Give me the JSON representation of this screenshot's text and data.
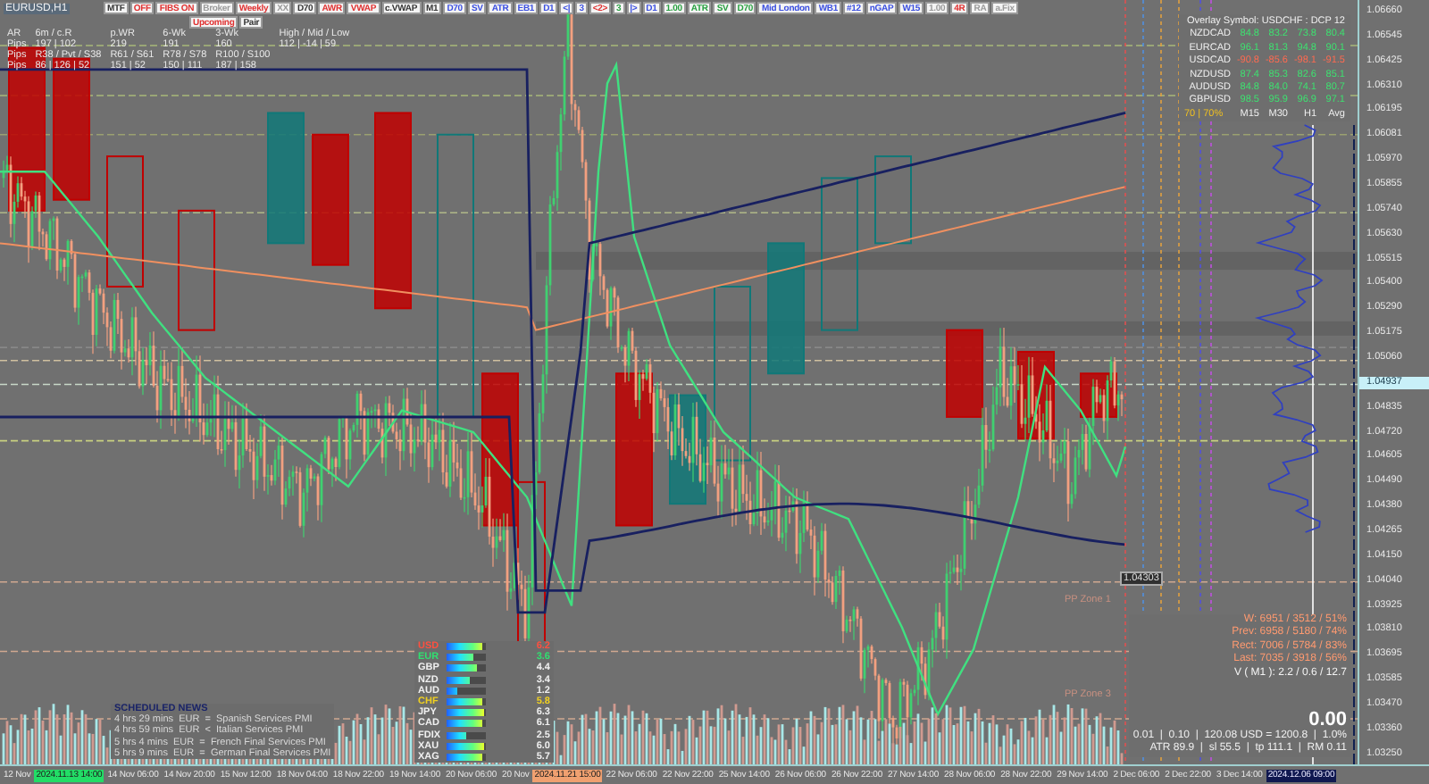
{
  "symbol": "EURUSD,H1",
  "toolbar": [
    {
      "label": "MTF",
      "color": "#333333"
    },
    {
      "label": "OFF",
      "color": "#e03030"
    },
    {
      "label": "FIBS ON",
      "color": "#e03030"
    },
    {
      "label": "Broker",
      "color": "#9a9a9a"
    },
    {
      "label": "Weekly",
      "color": "#e03030"
    },
    {
      "label": "XX",
      "color": "#9a9a9a"
    },
    {
      "label": "D70",
      "color": "#333333"
    },
    {
      "label": "AWR",
      "color": "#e03030"
    },
    {
      "label": "VWAP",
      "color": "#e03030"
    },
    {
      "label": "c.VWAP",
      "color": "#333333"
    },
    {
      "label": "M1",
      "color": "#333333"
    },
    {
      "label": "D70",
      "color": "#3a4ee0"
    },
    {
      "label": "SV",
      "color": "#3a4ee0"
    },
    {
      "label": "ATR",
      "color": "#3a4ee0"
    },
    {
      "label": "EB1",
      "color": "#3a4ee0"
    },
    {
      "label": "D1",
      "color": "#3a4ee0"
    },
    {
      "label": "<|",
      "color": "#3a4ee0"
    },
    {
      "label": "3",
      "color": "#3a4ee0"
    },
    {
      "label": "<2>",
      "color": "#e03030"
    },
    {
      "label": "3",
      "color": "#28a040"
    },
    {
      "label": "|>",
      "color": "#3a4ee0"
    },
    {
      "label": "D1",
      "color": "#3a4ee0"
    },
    {
      "label": "1.00",
      "color": "#28a040"
    },
    {
      "label": "ATR",
      "color": "#28a040"
    },
    {
      "label": "SV",
      "color": "#28a040"
    },
    {
      "label": "D70",
      "color": "#28a040"
    },
    {
      "label": "Mid London",
      "color": "#3a4ee0"
    },
    {
      "label": "WB1",
      "color": "#3a4ee0"
    },
    {
      "label": "#12",
      "color": "#3a4ee0"
    },
    {
      "label": "nGAP",
      "color": "#3a4ee0"
    },
    {
      "label": "W15",
      "color": "#3a4ee0"
    },
    {
      "label": "1.00",
      "color": "#9a9a9a"
    },
    {
      "label": "4R",
      "color": "#e03030"
    },
    {
      "label": "RA",
      "color": "#9a9a9a"
    },
    {
      "label": "a.Fix",
      "color": "#9a9a9a"
    }
  ],
  "toolbar_row_2": [
    {
      "label": "Upcoming",
      "color": "#e03030"
    },
    {
      "label": "Pair",
      "color": "#333333"
    }
  ],
  "info_table": {
    "rows": [
      [
        "AR",
        "6m / c.R",
        "p.WR",
        "6-Wk",
        "3-Wk",
        "High / Mid / Low"
      ],
      [
        "Pips",
        "197 | 102",
        "219",
        "191",
        "160",
        "112 | -14 | 59"
      ],
      [
        "Pips",
        "R38 / Pvt / S38",
        "R61 / S61",
        "R78 / S78",
        "R100 / S100",
        ""
      ],
      [
        "Pips",
        "86 | 126 | 52",
        "151 | 52",
        "150 | 111",
        "187 | 158",
        ""
      ]
    ]
  },
  "overlay_panel": {
    "title": "Overlay Symbol: USDCHF : DCP 12",
    "rows": [
      {
        "pair": "NZDCAD",
        "values": [
          "84.8",
          "83.2",
          "73.8",
          "80.4"
        ],
        "color": "#3ee070"
      },
      {
        "pair": "EURCAD",
        "values": [
          "96.1",
          "81.3",
          "94.8",
          "90.1"
        ],
        "color": "#3ee070"
      },
      {
        "pair": "USDCAD",
        "values": [
          "-90.8",
          "-85.6",
          "-98.1",
          "-91.5"
        ],
        "color": "#ff6a50"
      },
      {
        "pair": "NZDUSD",
        "values": [
          "87.4",
          "85.3",
          "82.6",
          "85.1"
        ],
        "color": "#3ee070"
      },
      {
        "pair": "AUDUSD",
        "values": [
          "84.8",
          "84.0",
          "74.1",
          "80.7"
        ],
        "color": "#3ee070"
      },
      {
        "pair": "GBPUSD",
        "values": [
          "98.5",
          "95.9",
          "96.9",
          "97.1"
        ],
        "color": "#3ee070"
      }
    ],
    "footer": [
      "70 | 70%",
      "M15",
      "M30",
      "H1",
      "Avg"
    ]
  },
  "strength": [
    {
      "name": "USD",
      "color": "#ff5040",
      "level": 0.9,
      "value": "6.2"
    },
    {
      "name": "EUR",
      "color": "#30e070",
      "level": 0.7,
      "value": "3.6"
    },
    {
      "name": "GBP",
      "color": "#f0f0f0",
      "level": 0.75,
      "value": "4.4"
    },
    {
      "name": "NZD",
      "color": "#f0f0f0",
      "level": 0.6,
      "value": "3.4"
    },
    {
      "name": "AUD",
      "color": "#f0f0f0",
      "level": 0.25,
      "value": "1.2"
    },
    {
      "name": "CHF",
      "color": "#f0d020",
      "level": 0.9,
      "value": "5.8"
    },
    {
      "name": "JPY",
      "color": "#f0f0f0",
      "level": 0.95,
      "value": "6.3"
    },
    {
      "name": "CAD",
      "color": "#f0f0f0",
      "level": 0.9,
      "value": "6.1"
    },
    {
      "name": "FDIX",
      "color": "#f0f0f0",
      "level": 0.5,
      "value": "2.5"
    },
    {
      "name": "XAU",
      "color": "#f0f0f0",
      "level": 0.95,
      "value": "6.0"
    },
    {
      "name": "XAG",
      "color": "#f0f0f0",
      "level": 0.9,
      "value": "5.7"
    }
  ],
  "news": {
    "title": "SCHEDULED NEWS",
    "items": [
      "4 hrs 29 mins  EUR  =  Spanish Services PMI",
      "4 hrs 59 mins  EUR  <  Italian Services PMI",
      "5 hrs 4 mins  EUR  =  French Final Services PMI",
      "5 hrs 9 mins  EUR  =  German Final Services PMI"
    ]
  },
  "stats": [
    {
      "text": "W: 6951 / 3512 / 51%",
      "color": "#ff9a70"
    },
    {
      "text": "Prev: 6958 / 5180 / 74%",
      "color": "#ff9a70"
    },
    {
      "text": "Rect: 7006 / 5784 / 83%",
      "color": "#ff9a70"
    },
    {
      "text": "Last: 7035 / 3918 / 56%",
      "color": "#ff9a70"
    },
    {
      "text": "V ( M1 ): 2.2 / 0.6 / 12.7",
      "color": "#f4f4f4"
    }
  ],
  "balance": "0.00",
  "risk_line": "0.01  |  0.10  |  120.08 USD = 1200.8  |  1.0%",
  "atr_line": "ATR 89.9  |  sl 55.5  |  tp 111.1  |  RM 0.11",
  "chart_labels": [
    {
      "text": "PP Zone 1",
      "kind": "zone"
    },
    {
      "text": "PP Zone 3",
      "kind": "zone"
    },
    {
      "text": "1.04303",
      "kind": "price"
    }
  ],
  "price_axis": [
    {
      "text": "1.06660"
    },
    {
      "text": "1.06545"
    },
    {
      "text": "1.06425"
    },
    {
      "text": "1.06310"
    },
    {
      "text": "1.06195"
    },
    {
      "text": "1.06081"
    },
    {
      "text": "1.05970"
    },
    {
      "text": "1.05855"
    },
    {
      "text": "1.05740"
    },
    {
      "text": "1.05630"
    },
    {
      "text": "1.05515"
    },
    {
      "text": "1.05400"
    },
    {
      "text": "1.05290"
    },
    {
      "text": "1.05175"
    },
    {
      "text": "1.05060"
    },
    {
      "text": "1.04937",
      "kind": "current"
    },
    {
      "text": "1.04835"
    },
    {
      "text": "1.04720"
    },
    {
      "text": "1.04605"
    },
    {
      "text": "1.04490"
    },
    {
      "text": "1.04380"
    },
    {
      "text": "1.04265"
    },
    {
      "text": "1.04150"
    },
    {
      "text": "1.04040"
    },
    {
      "text": "1.03925"
    },
    {
      "text": "1.03810"
    },
    {
      "text": "1.03695"
    },
    {
      "text": "1.03585"
    },
    {
      "text": "1.03470"
    },
    {
      "text": "1.03360"
    },
    {
      "text": "1.03250"
    }
  ],
  "time_axis": [
    {
      "text": "12 Nov"
    },
    {
      "text": "2024.11.13 14:00",
      "color": "#22dd66"
    },
    {
      "text": "14 Nov 06:00"
    },
    {
      "text": "14 Nov 20:00"
    },
    {
      "text": "15 Nov 12:00"
    },
    {
      "text": "18 Nov 04:00"
    },
    {
      "text": "18 Nov 22:00"
    },
    {
      "text": "19 Nov 14:00"
    },
    {
      "text": "20 Nov 06:00"
    },
    {
      "text": "20 Nov"
    },
    {
      "text": "2024.11.21 15:00",
      "color": "#f0a070"
    },
    {
      "text": "22 Nov 06:00"
    },
    {
      "text": "22 Nov 22:00"
    },
    {
      "text": "25 Nov 14:00"
    },
    {
      "text": "26 Nov 06:00"
    },
    {
      "text": "26 Nov 22:00"
    },
    {
      "text": "27 Nov 14:00"
    },
    {
      "text": "28 Nov 06:00"
    },
    {
      "text": "28 Nov 22:00"
    },
    {
      "text": "29 Nov 14:00"
    },
    {
      "text": "2 Dec 06:00"
    },
    {
      "text": "2 Dec 22:00"
    },
    {
      "text": "3 Dec 14:00"
    },
    {
      "text": "2024.12.06 09:00",
      "color": "#101850"
    }
  ]
}
